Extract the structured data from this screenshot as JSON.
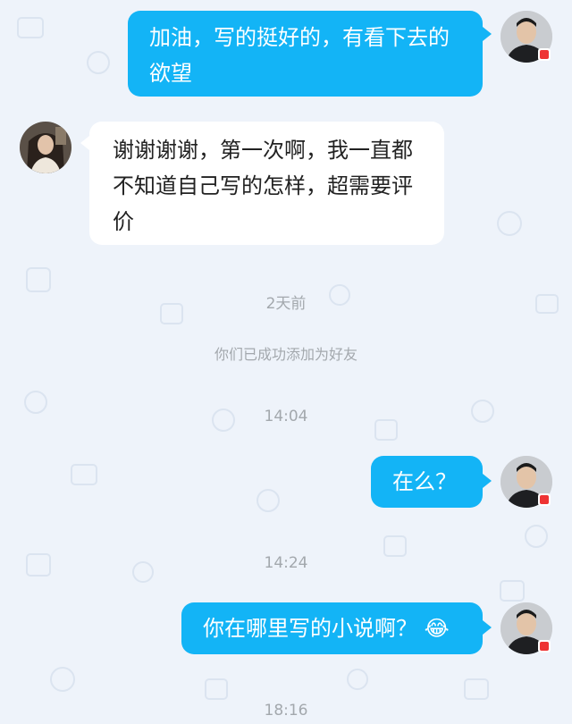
{
  "messages": [
    {
      "side": "out",
      "text": "加油，写的挺好的，有看下去的欲望"
    },
    {
      "side": "in",
      "text": "谢谢谢谢，第一次啊，我一直都不知道自己写的怎样，超需要评价"
    },
    {
      "side": "out",
      "text": "在么？"
    },
    {
      "side": "out",
      "text": "你在哪里写的小说啊？",
      "emoji": "😂"
    }
  ],
  "timestamps": {
    "t1": "2天前",
    "t2": "14:04",
    "t3": "14:24",
    "t4": "18:16"
  },
  "system": {
    "friend_added": "你们已成功添加为好友"
  },
  "colors": {
    "outgoing_bubble": "#13b4f6",
    "incoming_bubble": "#ffffff",
    "background": "#eef3fa",
    "timestamp_text": "#a3a8ad"
  }
}
